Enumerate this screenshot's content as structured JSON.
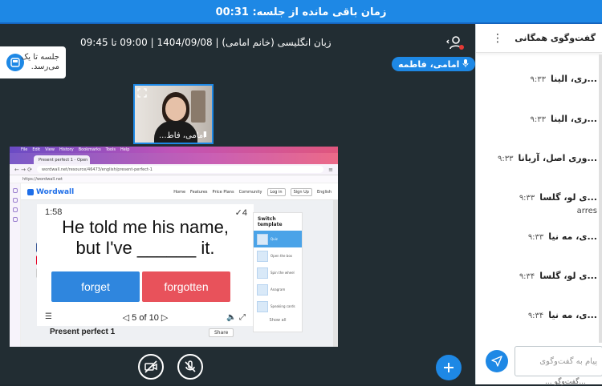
{
  "header": {
    "time_remaining": "زمان باقی مانده از جلسه: 00:31"
  },
  "meeting": {
    "title": "زبان انگلیسی (خانم امامی) | 1404/09/08 | 09:00 تا 09:45",
    "notice_line1": "جلسه تا یک",
    "notice_line2": "می‌رسد.",
    "presenter_name": "امامی، فاطمه",
    "webcam_label": "امامی، فاط..."
  },
  "shared_screen": {
    "browser_menu": [
      "File",
      "Edit",
      "View",
      "History",
      "Bookmarks",
      "Tools",
      "Help"
    ],
    "tab_title": "Present perfect 1 - Open",
    "url": "wordwall.net/resource/46473/english/present-perfect-1",
    "bookmark": "https://wordwall.net",
    "site": {
      "logo": "Wordwall",
      "nav": [
        "Home",
        "Features",
        "Price Plans",
        "Community"
      ],
      "login": "Log in",
      "signup": "Sign Up",
      "language": "English"
    },
    "game": {
      "timer": "1:58",
      "score": "✓4",
      "question_line1": "He told me his name,",
      "question_line2": "but I've ______ it.",
      "option_a": "forget",
      "option_b": "forgotten",
      "pager": "◁ 5 of 10 ▷",
      "activity_title": "Present perfect 1",
      "share": "Share"
    },
    "switch_template": {
      "title": "Switch template",
      "items": [
        "Quiz",
        "Open the box",
        "Spin the wheel",
        "Anagram",
        "Speaking cards"
      ],
      "show_all": "Show all"
    }
  },
  "chat": {
    "title": "گفت‌وگوی همگانی",
    "messages": [
      {
        "name": "...ری، الینا",
        "time": "۹:۳۳"
      },
      {
        "name": "...ری، الینا",
        "time": "۹:۳۳"
      },
      {
        "name": "...وری اصل، آریانا",
        "time": "۹:۳۳"
      },
      {
        "name": "...ی لو، گلسا",
        "time": "۹:۳۳",
        "extra": "arres"
      },
      {
        "name": "...ی، مه نیا",
        "time": "۹:۳۳"
      },
      {
        "name": "...ی لو، گلسا",
        "time": "۹:۳۴"
      },
      {
        "name": "...ی، مه نیا",
        "time": "۹:۳۴"
      }
    ],
    "input_placeholder": "پیام به گفت‌وگوی",
    "footer": "...گفت‌وگو ..."
  },
  "colors": {
    "accent": "#1e88e5",
    "stage_bg": "#222d33",
    "wrong": "#e8525b",
    "choice": "#2f86de"
  }
}
